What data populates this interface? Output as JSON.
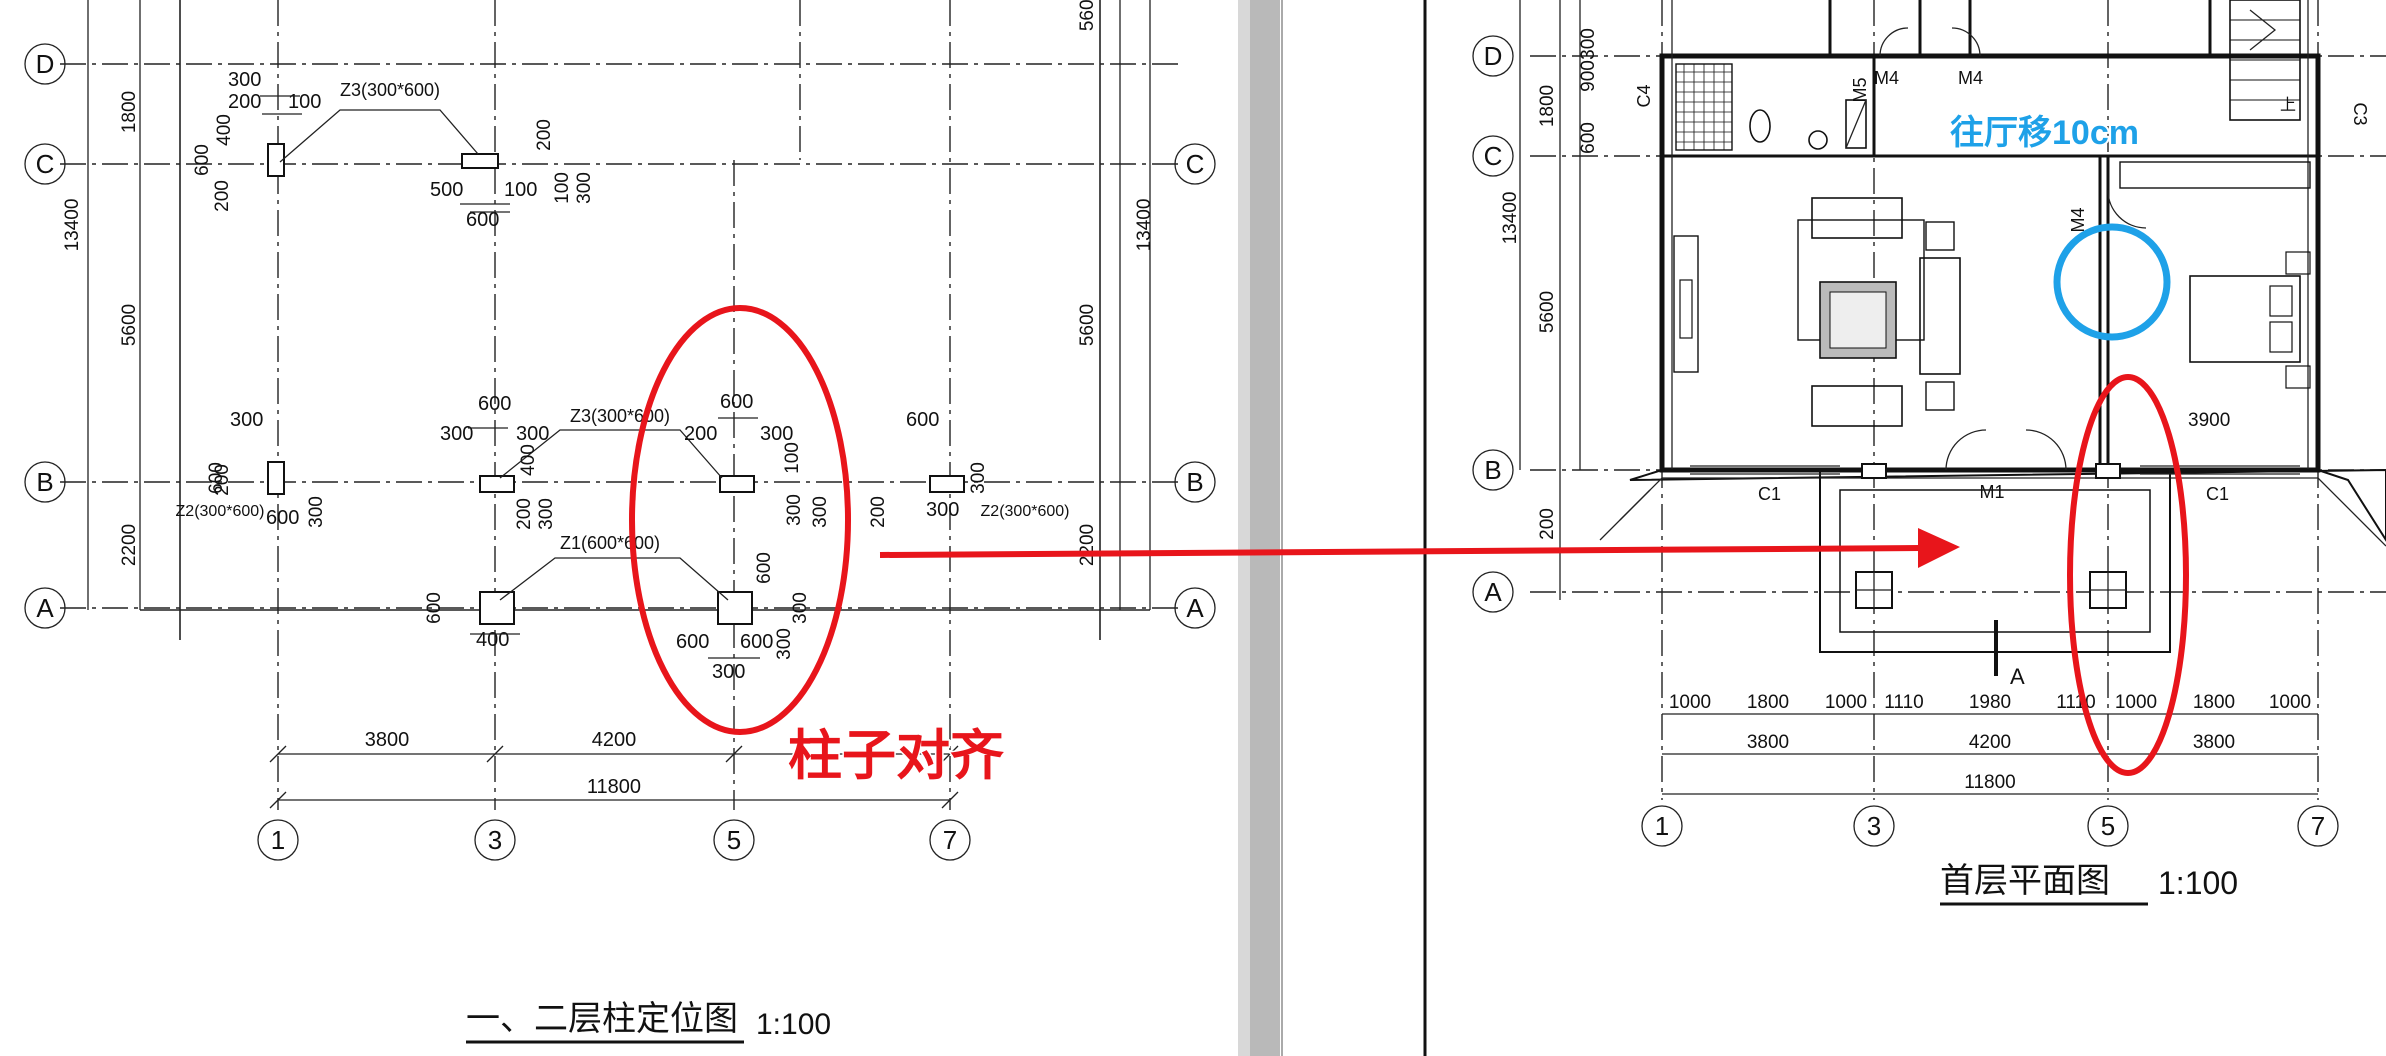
{
  "left_drawing": {
    "title": "一、二层柱定位图",
    "scale": "1:100",
    "axis_rows": [
      "D",
      "C",
      "B",
      "A"
    ],
    "axis_cols": [
      "1",
      "3",
      "5",
      "7"
    ],
    "left_dims": [
      "1800",
      "13400",
      "5600",
      "2200"
    ],
    "right_dims": [
      "5600",
      "13400",
      "5600",
      "2200"
    ],
    "bottom_dims": [
      "3800",
      "4200",
      "11800"
    ],
    "column_tags": [
      "Z3(300*600)",
      "Z3(300*600)",
      "Z2(300*600)",
      "Z2(300*600)",
      "Z1(600*600)"
    ],
    "small_dims": [
      "300",
      "200",
      "100",
      "400",
      "600",
      "200",
      "500",
      "100",
      "600",
      "200",
      "100",
      "300",
      "300",
      "600",
      "200",
      "600",
      "300",
      "600",
      "300",
      "300",
      "400",
      "200",
      "300",
      "200",
      "100",
      "300",
      "600",
      "300",
      "300",
      "600",
      "200",
      "300",
      "300",
      "600",
      "400",
      "600",
      "600",
      "600",
      "300",
      "300",
      "300",
      "600",
      "300",
      "600",
      "200",
      "300"
    ]
  },
  "right_drawing": {
    "title": "首层平面图",
    "scale": "1:100",
    "axis_rows": [
      "D",
      "C",
      "B",
      "A"
    ],
    "axis_cols": [
      "1",
      "3",
      "5",
      "7"
    ],
    "left_dims": [
      "1800",
      "900",
      "300",
      "600",
      "13400",
      "5600",
      "200"
    ],
    "bottom_row1": [
      "1000",
      "1800",
      "1000",
      "1110",
      "1980",
      "1110",
      "1000",
      "1800",
      "1000"
    ],
    "bottom_row2": [
      "3800",
      "4200",
      "3800"
    ],
    "bottom_total": "11800",
    "room_dim": "3900",
    "door_tags": [
      "M4",
      "M4",
      "M5",
      "M4",
      "M1"
    ],
    "window_tags": [
      "C4",
      "C3",
      "C1",
      "C1"
    ],
    "section_tag": "A",
    "stair_tag": "上"
  },
  "annotations": {
    "align_note": "柱子对齐",
    "move_note": "往厅移10cm",
    "red_color": "#e8151b",
    "blue_color": "#1ea1e8"
  }
}
